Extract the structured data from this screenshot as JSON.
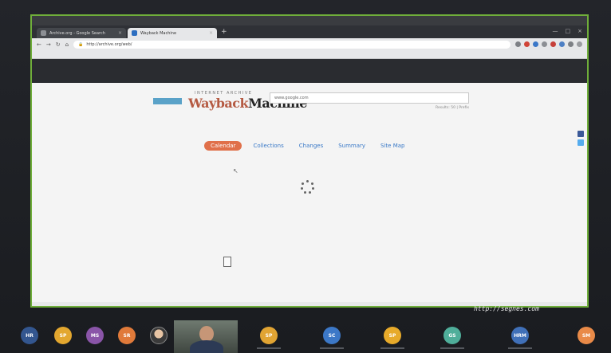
{
  "browser": {
    "tabs": [
      {
        "title": "Archive.org - Google Search",
        "active": false
      },
      {
        "title": "Wayback Machine",
        "active": true
      }
    ],
    "url": "http://archive.org/web/"
  },
  "wayback": {
    "brand_small": "INTERNET ARCHIVE",
    "brand_wayback": "Wayback",
    "brand_machine": "Machine",
    "search_value": "www.google.com",
    "results_link": "Results: 50 | Prefix",
    "tabs": [
      {
        "label": "Calendar",
        "active": true
      },
      {
        "label": "Collections",
        "active": false
      },
      {
        "label": "Changes",
        "active": false
      },
      {
        "label": "Summary",
        "active": false
      },
      {
        "label": "Site Map",
        "active": false
      }
    ]
  },
  "watermark": "http://segnes.com",
  "participants": [
    {
      "initials": "HR",
      "color": "#33568f"
    },
    {
      "initials": "SP",
      "color": "#e3a72f"
    },
    {
      "initials": "MS",
      "color": "#8a55a8"
    },
    {
      "initials": "SR",
      "color": "#e07a3a"
    },
    {
      "initials": "",
      "color": "#7a6b5c"
    },
    {
      "initials": "SP",
      "color": "#e1a433"
    },
    {
      "initials": "SC",
      "color": "#3c78c7"
    },
    {
      "initials": "SP",
      "color": "#e7aa2a"
    },
    {
      "initials": "GS",
      "color": "#4fae9a"
    },
    {
      "initials": "HRM",
      "color": "#4070b8"
    },
    {
      "initials": "SM",
      "color": "#e98a48"
    }
  ],
  "colors": {
    "share_border": "#6fae3a",
    "wayback_accent": "#e0704a",
    "link_blue": "#3a79c7"
  }
}
